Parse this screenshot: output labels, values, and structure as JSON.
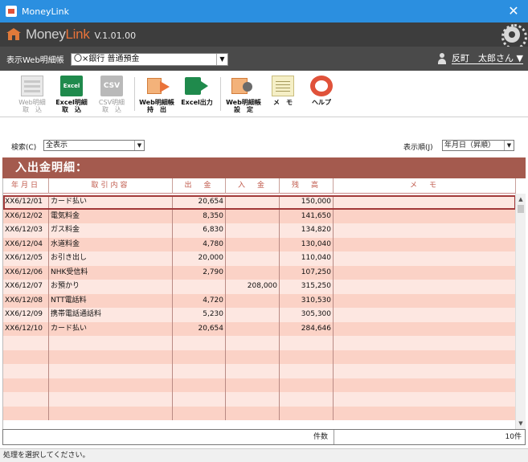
{
  "window": {
    "title": "MoneyLink",
    "close_glyph": "✕"
  },
  "header": {
    "logo_part1": "Money",
    "logo_part2": "Link",
    "version": "V.1.01.00"
  },
  "account_bar": {
    "label": "表示Web明細帳",
    "selected_account": "〇×銀行 普通預金",
    "user_name": "反町　太郎さん ▼"
  },
  "toolbar": {
    "web_detail": {
      "line1": "Web明細",
      "line2": "取　込"
    },
    "excel_detail": {
      "icon": "Excel",
      "line1": "Excel明細",
      "line2": "取　込"
    },
    "csv_detail": {
      "icon": "CSV",
      "line1": "CSV明細",
      "line2": "取　込"
    },
    "web_export": {
      "line1": "Web明細帳",
      "line2": "持　出"
    },
    "excel_output": {
      "line1": "Excel出力"
    },
    "web_settings": {
      "line1": "Web明細帳",
      "line2": "設　定"
    },
    "memo": {
      "line1": "メ　モ"
    },
    "help": {
      "line1": "ヘルプ"
    }
  },
  "filters": {
    "search_label": "検索(C)",
    "search_value": "全表示",
    "sort_label": "表示順(J)",
    "sort_value": "年月日（昇順）"
  },
  "section_title": "入出金明細：",
  "table": {
    "columns": [
      "年月日",
      "取引内容",
      "出　金",
      "入　金",
      "残　高",
      "メ　モ"
    ],
    "rows": [
      [
        "XX6/12/01",
        "カード払い",
        "20,654",
        "",
        "150,000",
        ""
      ],
      [
        "XX6/12/02",
        "電気料金",
        "8,350",
        "",
        "141,650",
        ""
      ],
      [
        "XX6/12/03",
        "ガス料金",
        "6,830",
        "",
        "134,820",
        ""
      ],
      [
        "XX6/12/04",
        "水道料金",
        "4,780",
        "",
        "130,040",
        ""
      ],
      [
        "XX6/12/05",
        "お引き出し",
        "20,000",
        "",
        "110,040",
        ""
      ],
      [
        "XX6/12/06",
        "NHK受信料",
        "2,790",
        "",
        "107,250",
        ""
      ],
      [
        "XX6/12/07",
        "お預かり",
        "",
        "208,000",
        "315,250",
        ""
      ],
      [
        "XX6/12/08",
        "NTT電話料",
        "4,720",
        "",
        "310,530",
        ""
      ],
      [
        "XX6/12/09",
        "携帯電話通話料",
        "5,230",
        "",
        "305,300",
        ""
      ],
      [
        "XX6/12/10",
        "カード払い",
        "20,654",
        "",
        "284,646",
        ""
      ],
      [
        "",
        "",
        "",
        "",
        "",
        ""
      ],
      [
        "",
        "",
        "",
        "",
        "",
        ""
      ],
      [
        "",
        "",
        "",
        "",
        "",
        ""
      ],
      [
        "",
        "",
        "",
        "",
        "",
        ""
      ],
      [
        "",
        "",
        "",
        "",
        "",
        ""
      ],
      [
        "",
        "",
        "",
        "",
        "",
        ""
      ]
    ]
  },
  "footer": {
    "count_label": "件数",
    "count_value": "10件"
  },
  "status": "処理を選択してください。"
}
